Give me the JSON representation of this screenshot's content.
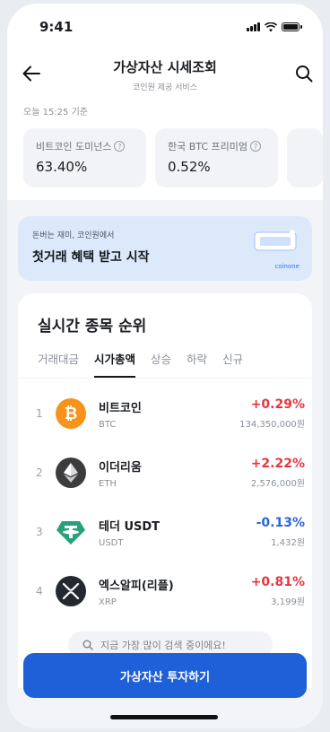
{
  "status_bar": {
    "time": "9:41"
  },
  "header": {
    "title": "가상자산 시세조회",
    "subtitle": "코인원 제공 서비스"
  },
  "timestamp": "오늘 15:25 기준",
  "metrics": [
    {
      "label": "비트코인 도미넌스",
      "value": "63.40%"
    },
    {
      "label": "한국 BTC 프리미엄",
      "value": "0.52%"
    }
  ],
  "banner": {
    "small_text": "돈버는 재미, 코인원에서",
    "main_text": "첫거래 혜택 받고 시작",
    "brand": "coinone"
  },
  "ranking": {
    "title": "실시간 종목 순위",
    "tabs": [
      "거래대금",
      "시가총액",
      "상승",
      "하락",
      "신규"
    ],
    "active_tab": "시가총액",
    "rows": [
      {
        "rank": "1",
        "name": "비트코인",
        "symbol": "BTC",
        "change": "+0.29%",
        "price": "134,350,000원",
        "icon": "bitcoin-icon",
        "color": "#f7931a"
      },
      {
        "rank": "2",
        "name": "이더리움",
        "symbol": "ETH",
        "change": "+2.22%",
        "price": "2,576,000원",
        "icon": "ethereum-icon",
        "color": "#3c3c3d"
      },
      {
        "rank": "3",
        "name": "테더 USDT",
        "symbol": "USDT",
        "change": "-0.13%",
        "price": "1,432원",
        "icon": "tether-icon",
        "color": "#26a17b"
      },
      {
        "rank": "4",
        "name": "엑스알피(리플)",
        "symbol": "XRP",
        "change": "+0.81%",
        "price": "3,199원",
        "icon": "xrp-icon",
        "color": "#23292f"
      }
    ]
  },
  "search_pill": {
    "text": "지금 가장 많이 검색 중이에요!"
  },
  "cta": {
    "label": "가상자산 투자하기"
  },
  "colors": {
    "accent": "#1e60d8",
    "up": "#e5363f",
    "down": "#2c64db",
    "banner_bg": "#dce9fb"
  }
}
